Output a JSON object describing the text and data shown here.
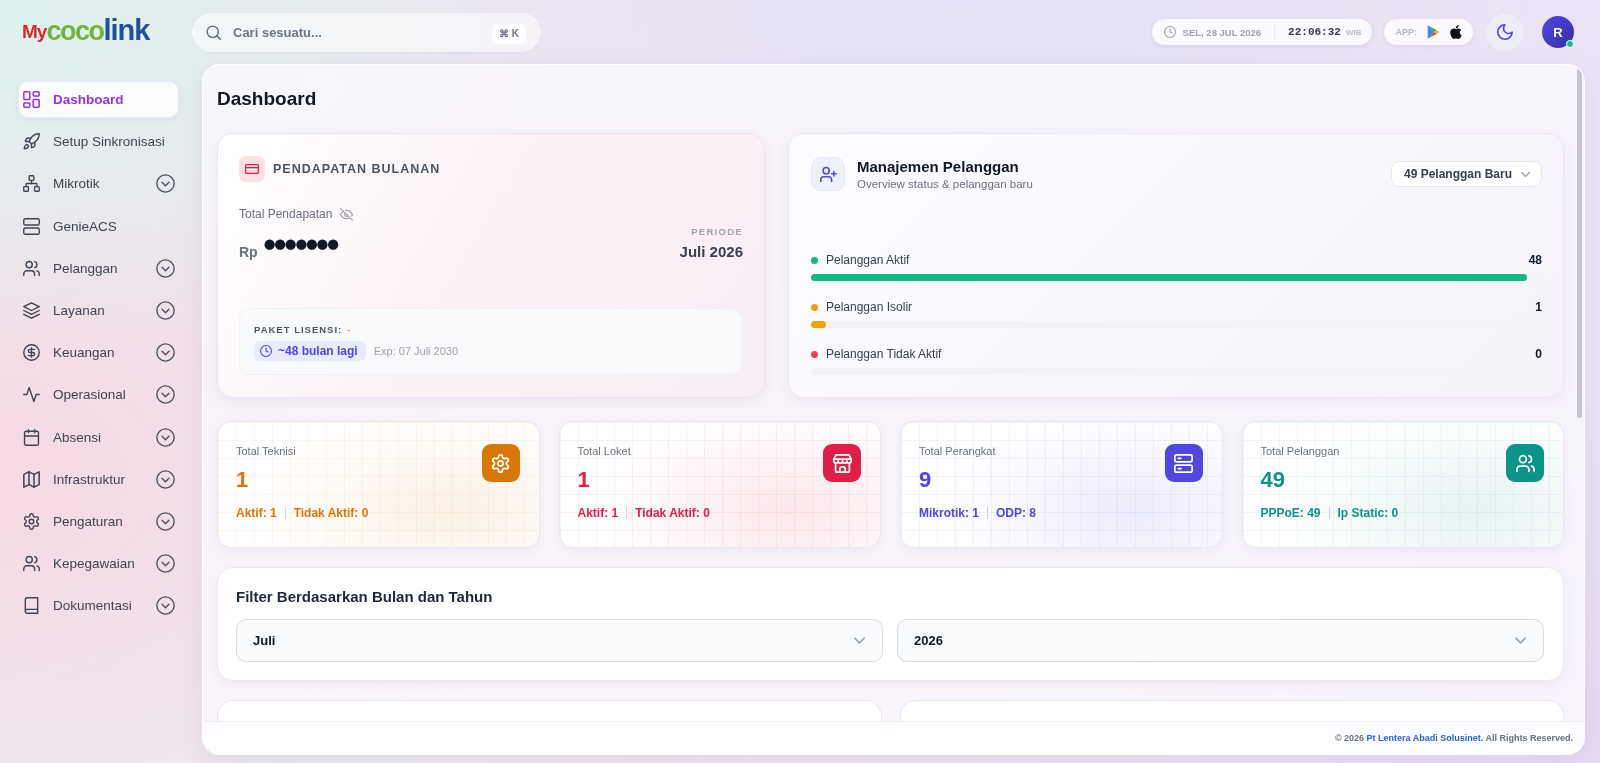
{
  "header": {
    "logo": [
      {
        "text": "My",
        "color": "#e3262b"
      },
      {
        "text": "coco",
        "color": "#72b43c"
      },
      {
        "text": "link",
        "color": "#1f4f9d"
      }
    ],
    "search": {
      "placeholder": "Cari sesuatu...",
      "shortcut": "⌘ K"
    },
    "clock": {
      "date": "SEL, 28 JUL 2026",
      "time": "22:06:32",
      "zone": "WIB"
    },
    "apps": {
      "label": "APP:"
    },
    "avatar": {
      "initial": "R",
      "online": true
    }
  },
  "sidebar": {
    "items": [
      {
        "label": "Dashboard",
        "kind": "link",
        "selected": true
      },
      {
        "label": "Setup Sinkronisasi",
        "kind": "link",
        "selected": false
      },
      {
        "label": "Mikrotik",
        "kind": "group",
        "selected": false
      },
      {
        "label": "GenieACS",
        "kind": "link",
        "selected": false
      },
      {
        "label": "Pelanggan",
        "kind": "group",
        "selected": false
      },
      {
        "label": "Layanan",
        "kind": "group",
        "selected": false
      },
      {
        "label": "Keuangan",
        "kind": "group",
        "selected": false
      },
      {
        "label": "Operasional",
        "kind": "group",
        "selected": false
      },
      {
        "label": "Absensi",
        "kind": "group",
        "selected": false
      },
      {
        "label": "Infrastruktur",
        "kind": "group",
        "selected": false
      },
      {
        "label": "Pengaturan",
        "kind": "group",
        "selected": false
      },
      {
        "label": "Kepegawaian",
        "kind": "group",
        "selected": false
      },
      {
        "label": "Dokumentasi",
        "kind": "group",
        "selected": false
      }
    ]
  },
  "page_title": "Dashboard",
  "revenue_card": {
    "title": "PENDAPATAN BULANAN",
    "total_label": "Total Pendapatan",
    "currency": "Rp",
    "amount": "●●●●●●●",
    "period_label": "PERIODE",
    "period": "Juli 2026",
    "license": {
      "label": "PAKET LISENSI:",
      "value": "-",
      "remaining": "~48 bulan lagi",
      "expiry": "Exp: 07 Juli 2030"
    }
  },
  "customer_card": {
    "title": "Manajemen Pelanggan",
    "subtitle": "Overview status & pelanggan baru",
    "dropdown": "49 Pelanggan Baru",
    "statuses": [
      {
        "label": "Pelanggan Aktif",
        "count": "48",
        "color": "#10b981",
        "level": 0.98
      },
      {
        "label": "Pelanggan Isolir",
        "count": "1",
        "color": "#f59e0b",
        "level": 0.02
      },
      {
        "label": "Pelanggan Tidak Aktif",
        "count": "0",
        "color": "#f43f5e",
        "level": 0
      }
    ]
  },
  "stats": [
    {
      "label": "Total Teknisi",
      "value": "1",
      "details": [
        "Aktif: 1",
        "Tidak Aktif: 0"
      ],
      "color": "#d97706"
    },
    {
      "label": "Total Loket",
      "value": "1",
      "details": [
        "Aktif: 1",
        "Tidak Aktif: 0"
      ],
      "color": "#e11d48"
    },
    {
      "label": "Total Perangkat",
      "value": "9",
      "details": [
        "Mikrotik: 1",
        "ODP: 8"
      ],
      "color": "#4f46e5"
    },
    {
      "label": "Total Pelanggan",
      "value": "49",
      "details": [
        "PPPoE: 49",
        "Ip Static: 0"
      ],
      "color": "#0d9488"
    }
  ],
  "filter": {
    "title": "Filter Berdasarkan Bulan dan Tahun",
    "month": "Juli",
    "year": "2026"
  },
  "footer": {
    "prefix": "© 2026",
    "company": "Pt Lentera Abadi Solusinet.",
    "suffix": "All Rights Reserved."
  }
}
